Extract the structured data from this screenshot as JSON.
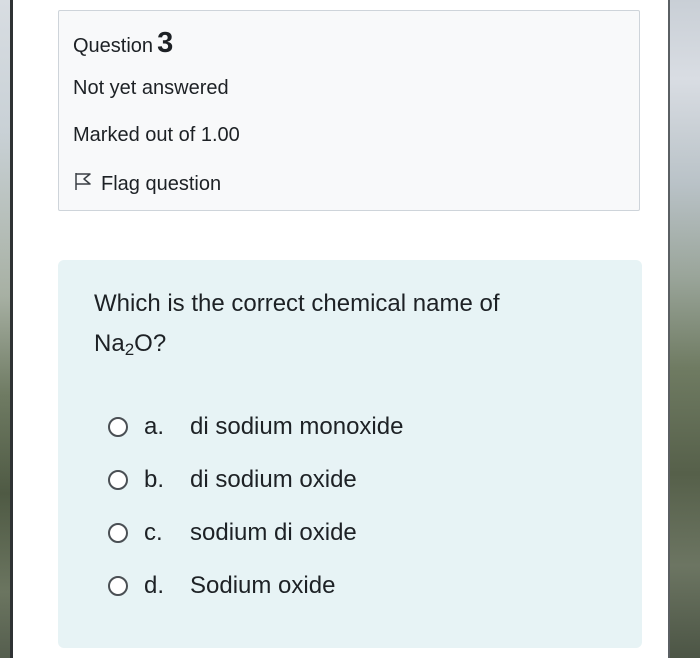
{
  "question": {
    "label": "Question",
    "number": "3",
    "state": "Not yet answered",
    "grade": "Marked out of 1.00",
    "flag_label": "Flag question"
  },
  "prompt": {
    "text_before": "Which is the correct chemical name of",
    "formula_main": "Na",
    "formula_sub": "2",
    "formula_tail": "O?"
  },
  "options": [
    {
      "letter": "a.",
      "text": "di sodium monoxide",
      "selected": false
    },
    {
      "letter": "b.",
      "text": "di sodium oxide",
      "selected": false
    },
    {
      "letter": "c.",
      "text": "sodium di oxide",
      "selected": false
    },
    {
      "letter": "d.",
      "text": "Sodium oxide",
      "selected": false
    }
  ],
  "colors": {
    "info_bg": "#f8f9fa",
    "question_bg": "#e7f3f5",
    "text": "#1d2125",
    "border": "#ced4da"
  },
  "icons": {
    "flag": "flag-icon",
    "radio": "radio-unchecked-icon"
  }
}
